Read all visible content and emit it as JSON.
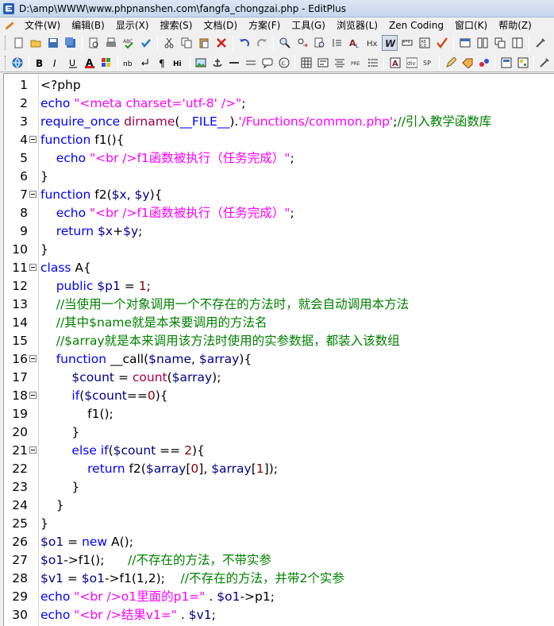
{
  "window": {
    "title": "D:\\amp\\WWW\\www.phpnanshen.com\\fangfa_chongzai.php - EditPlus"
  },
  "menu": [
    "文件(W)",
    "编辑(B)",
    "显示(X)",
    "搜索(S)",
    "文档(D)",
    "方案(F)",
    "工具(G)",
    "浏览器(L)",
    "Zen Coding",
    "窗口(K)",
    "帮助(Z)"
  ],
  "toolbar1": [
    "new-file-icon",
    "open-folder-icon",
    "save-icon",
    "save-all-icon",
    "sep",
    "print-preview-icon",
    "print-icon",
    "spell-check-icon",
    "check-icon",
    "sep",
    "cut-icon",
    "copy-icon",
    "paste-icon",
    "delete-icon",
    "sep",
    "undo-icon",
    "redo-icon",
    "sep",
    "find-icon",
    "replace-icon",
    "find-in-files-icon",
    "insert-icon",
    "font-icon",
    "hex-icon",
    "word-wrap-icon",
    "ruler-icon",
    "line-number-icon",
    "check-mark-icon",
    "sep",
    "window-icon",
    "tile-icon",
    "cascade-icon",
    "file-window-icon",
    "sep",
    "config-icon"
  ],
  "toolbar2": [
    "browser-icon",
    "sep",
    "bold-icon",
    "italic-icon",
    "underline-icon",
    "font-color-icon",
    "highlight-icon",
    "sep",
    "nbsp-icon",
    "line-break-icon",
    "paragraph-icon",
    "heading-icon",
    "sep",
    "image-icon",
    "anchor-icon",
    "hr-icon",
    "table-icon",
    "comment-icon",
    "copyright-icon",
    "sep",
    "table-insert-icon",
    "form-icon",
    "center-icon",
    "pre-icon",
    "list-icon",
    "sep",
    "font-a-icon",
    "div-icon",
    "span-icon",
    "sep",
    "edit-icon",
    "tag-icon",
    "script-icon",
    "sep",
    "view-icon",
    "grid-icon",
    "sep",
    "config-icon"
  ],
  "code": [
    {
      "n": "1",
      "fold": false,
      "tokens": [
        [
          "t",
          "<?php"
        ]
      ]
    },
    {
      "n": "2",
      "fold": false,
      "tokens": [
        [
          "k",
          "echo "
        ],
        [
          "s",
          "\"<meta charset='utf-8' />\""
        ],
        [
          "t",
          ";"
        ]
      ]
    },
    {
      "n": "3",
      "fold": false,
      "tokens": [
        [
          "k",
          "require_once "
        ],
        [
          "f",
          "dirname"
        ],
        [
          "t",
          "("
        ],
        [
          "k",
          "__FILE__"
        ],
        [
          "t",
          ")."
        ],
        [
          "s",
          "'/Functions/common.php'"
        ],
        [
          "t",
          ";"
        ],
        [
          "c",
          "//引入教学函数库"
        ]
      ]
    },
    {
      "n": "4",
      "fold": true,
      "tokens": [
        [
          "k",
          "function "
        ],
        [
          "t",
          "f1(){"
        ]
      ]
    },
    {
      "n": "5",
      "fold": false,
      "tokens": [
        [
          "t",
          "    "
        ],
        [
          "k",
          "echo "
        ],
        [
          "s",
          "\"<br />f1函数被执行（任务完成）\""
        ],
        [
          "t",
          ";"
        ]
      ]
    },
    {
      "n": "6",
      "fold": false,
      "tokens": [
        [
          "t",
          "}"
        ]
      ]
    },
    {
      "n": "7",
      "fold": true,
      "tokens": [
        [
          "k",
          "function "
        ],
        [
          "t",
          "f2("
        ],
        [
          "v",
          "$x"
        ],
        [
          "t",
          ", "
        ],
        [
          "v",
          "$y"
        ],
        [
          "t",
          "){"
        ]
      ]
    },
    {
      "n": "8",
      "fold": false,
      "tokens": [
        [
          "t",
          "    "
        ],
        [
          "k",
          "echo "
        ],
        [
          "s",
          "\"<br />f1函数被执行（任务完成）\""
        ],
        [
          "t",
          ";"
        ]
      ]
    },
    {
      "n": "9",
      "fold": false,
      "tokens": [
        [
          "t",
          "    "
        ],
        [
          "k",
          "return "
        ],
        [
          "v",
          "$x"
        ],
        [
          "t",
          "+"
        ],
        [
          "v",
          "$y"
        ],
        [
          "t",
          ";"
        ]
      ]
    },
    {
      "n": "10",
      "fold": false,
      "tokens": [
        [
          "t",
          "}"
        ]
      ]
    },
    {
      "n": "11",
      "fold": true,
      "tokens": [
        [
          "k",
          "class "
        ],
        [
          "t",
          "A{"
        ]
      ]
    },
    {
      "n": "12",
      "fold": false,
      "tokens": [
        [
          "t",
          "    "
        ],
        [
          "k",
          "public "
        ],
        [
          "v",
          "$p1"
        ],
        [
          "t",
          " = "
        ],
        [
          "p",
          "1"
        ],
        [
          "t",
          ";"
        ]
      ]
    },
    {
      "n": "13",
      "fold": false,
      "tokens": [
        [
          "t",
          "    "
        ],
        [
          "c",
          "//当使用一个对象调用一个不存在的方法时，就会自动调用本方法"
        ]
      ]
    },
    {
      "n": "14",
      "fold": false,
      "tokens": [
        [
          "t",
          "    "
        ],
        [
          "c",
          "//其中$name就是本来要调用的方法名"
        ]
      ]
    },
    {
      "n": "15",
      "fold": false,
      "tokens": [
        [
          "t",
          "    "
        ],
        [
          "c",
          "//$array就是本来调用该方法时使用的实参数据，都装入该数组"
        ]
      ]
    },
    {
      "n": "16",
      "fold": true,
      "tokens": [
        [
          "t",
          "    "
        ],
        [
          "k",
          "function "
        ],
        [
          "t",
          "__call("
        ],
        [
          "v",
          "$name"
        ],
        [
          "t",
          ", "
        ],
        [
          "v",
          "$array"
        ],
        [
          "t",
          "){"
        ]
      ]
    },
    {
      "n": "17",
      "fold": false,
      "tokens": [
        [
          "t",
          "        "
        ],
        [
          "v",
          "$count"
        ],
        [
          "t",
          " = "
        ],
        [
          "f",
          "count"
        ],
        [
          "t",
          "("
        ],
        [
          "v",
          "$array"
        ],
        [
          "t",
          ");"
        ]
      ]
    },
    {
      "n": "18",
      "fold": true,
      "tokens": [
        [
          "t",
          "        "
        ],
        [
          "k",
          "if"
        ],
        [
          "t",
          "("
        ],
        [
          "v",
          "$count"
        ],
        [
          "t",
          "=="
        ],
        [
          "p",
          "0"
        ],
        [
          "t",
          "){"
        ]
      ]
    },
    {
      "n": "19",
      "fold": false,
      "tokens": [
        [
          "t",
          "            f1();"
        ]
      ]
    },
    {
      "n": "20",
      "fold": false,
      "tokens": [
        [
          "t",
          "        }"
        ]
      ]
    },
    {
      "n": "21",
      "fold": true,
      "tokens": [
        [
          "t",
          "        "
        ],
        [
          "k",
          "else if"
        ],
        [
          "t",
          "("
        ],
        [
          "v",
          "$count"
        ],
        [
          "t",
          " == "
        ],
        [
          "p",
          "2"
        ],
        [
          "t",
          "){"
        ]
      ]
    },
    {
      "n": "22",
      "fold": false,
      "tokens": [
        [
          "t",
          "            "
        ],
        [
          "k",
          "return "
        ],
        [
          "t",
          "f2("
        ],
        [
          "v",
          "$array"
        ],
        [
          "t",
          "["
        ],
        [
          "p",
          "0"
        ],
        [
          "t",
          "], "
        ],
        [
          "v",
          "$array"
        ],
        [
          "t",
          "["
        ],
        [
          "p",
          "1"
        ],
        [
          "t",
          "]);"
        ]
      ]
    },
    {
      "n": "23",
      "fold": false,
      "tokens": [
        [
          "t",
          "        }"
        ]
      ]
    },
    {
      "n": "24",
      "fold": false,
      "tokens": [
        [
          "t",
          "    }"
        ]
      ]
    },
    {
      "n": "25",
      "fold": false,
      "tokens": [
        [
          "t",
          "}"
        ]
      ]
    },
    {
      "n": "26",
      "fold": false,
      "tokens": [
        [
          "v",
          "$o1"
        ],
        [
          "t",
          " = "
        ],
        [
          "k",
          "new "
        ],
        [
          "t",
          "A();"
        ]
      ]
    },
    {
      "n": "27",
      "fold": false,
      "tokens": [
        [
          "v",
          "$o1"
        ],
        [
          "t",
          "->f1();      "
        ],
        [
          "c",
          "//不存在的方法，不带实参"
        ]
      ]
    },
    {
      "n": "28",
      "fold": false,
      "tokens": [
        [
          "v",
          "$v1"
        ],
        [
          "t",
          " = "
        ],
        [
          "v",
          "$o1"
        ],
        [
          "t",
          "->f1(1,2);    "
        ],
        [
          "c",
          "//不存在的方法，并带2个实参"
        ]
      ]
    },
    {
      "n": "29",
      "fold": false,
      "tokens": [
        [
          "k",
          "echo "
        ],
        [
          "s",
          "\"<br />o1里面的p1=\""
        ],
        [
          "t",
          " . "
        ],
        [
          "v",
          "$o1"
        ],
        [
          "t",
          "->p1;"
        ]
      ]
    },
    {
      "n": "30",
      "fold": false,
      "tokens": [
        [
          "k",
          "echo "
        ],
        [
          "s",
          "\"<br />结果v1=\""
        ],
        [
          "t",
          " . "
        ],
        [
          "v",
          "$v1"
        ],
        [
          "t",
          ";"
        ]
      ]
    }
  ]
}
